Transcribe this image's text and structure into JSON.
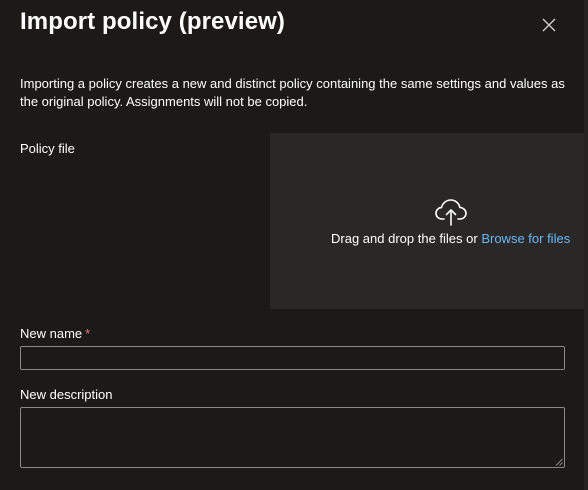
{
  "dialog": {
    "title": "Import policy (preview)",
    "close_icon": "close-icon",
    "description": "Importing a policy creates a new and distinct policy containing the same settings and values as the original policy. Assignments will not be copied."
  },
  "policy_file": {
    "label": "Policy file",
    "upload_icon": "cloud-upload-icon",
    "drop_text": "Drag and drop the files or",
    "browse_link": "Browse for files"
  },
  "new_name": {
    "label": "New name",
    "required_marker": "*",
    "value": "",
    "placeholder": ""
  },
  "new_description": {
    "label": "New description",
    "value": "",
    "placeholder": ""
  },
  "colors": {
    "background": "#1b1a19",
    "dropzone": "#292827",
    "link": "#6cb8f6",
    "required": "#f1707b",
    "input_border": "#8a8886"
  }
}
